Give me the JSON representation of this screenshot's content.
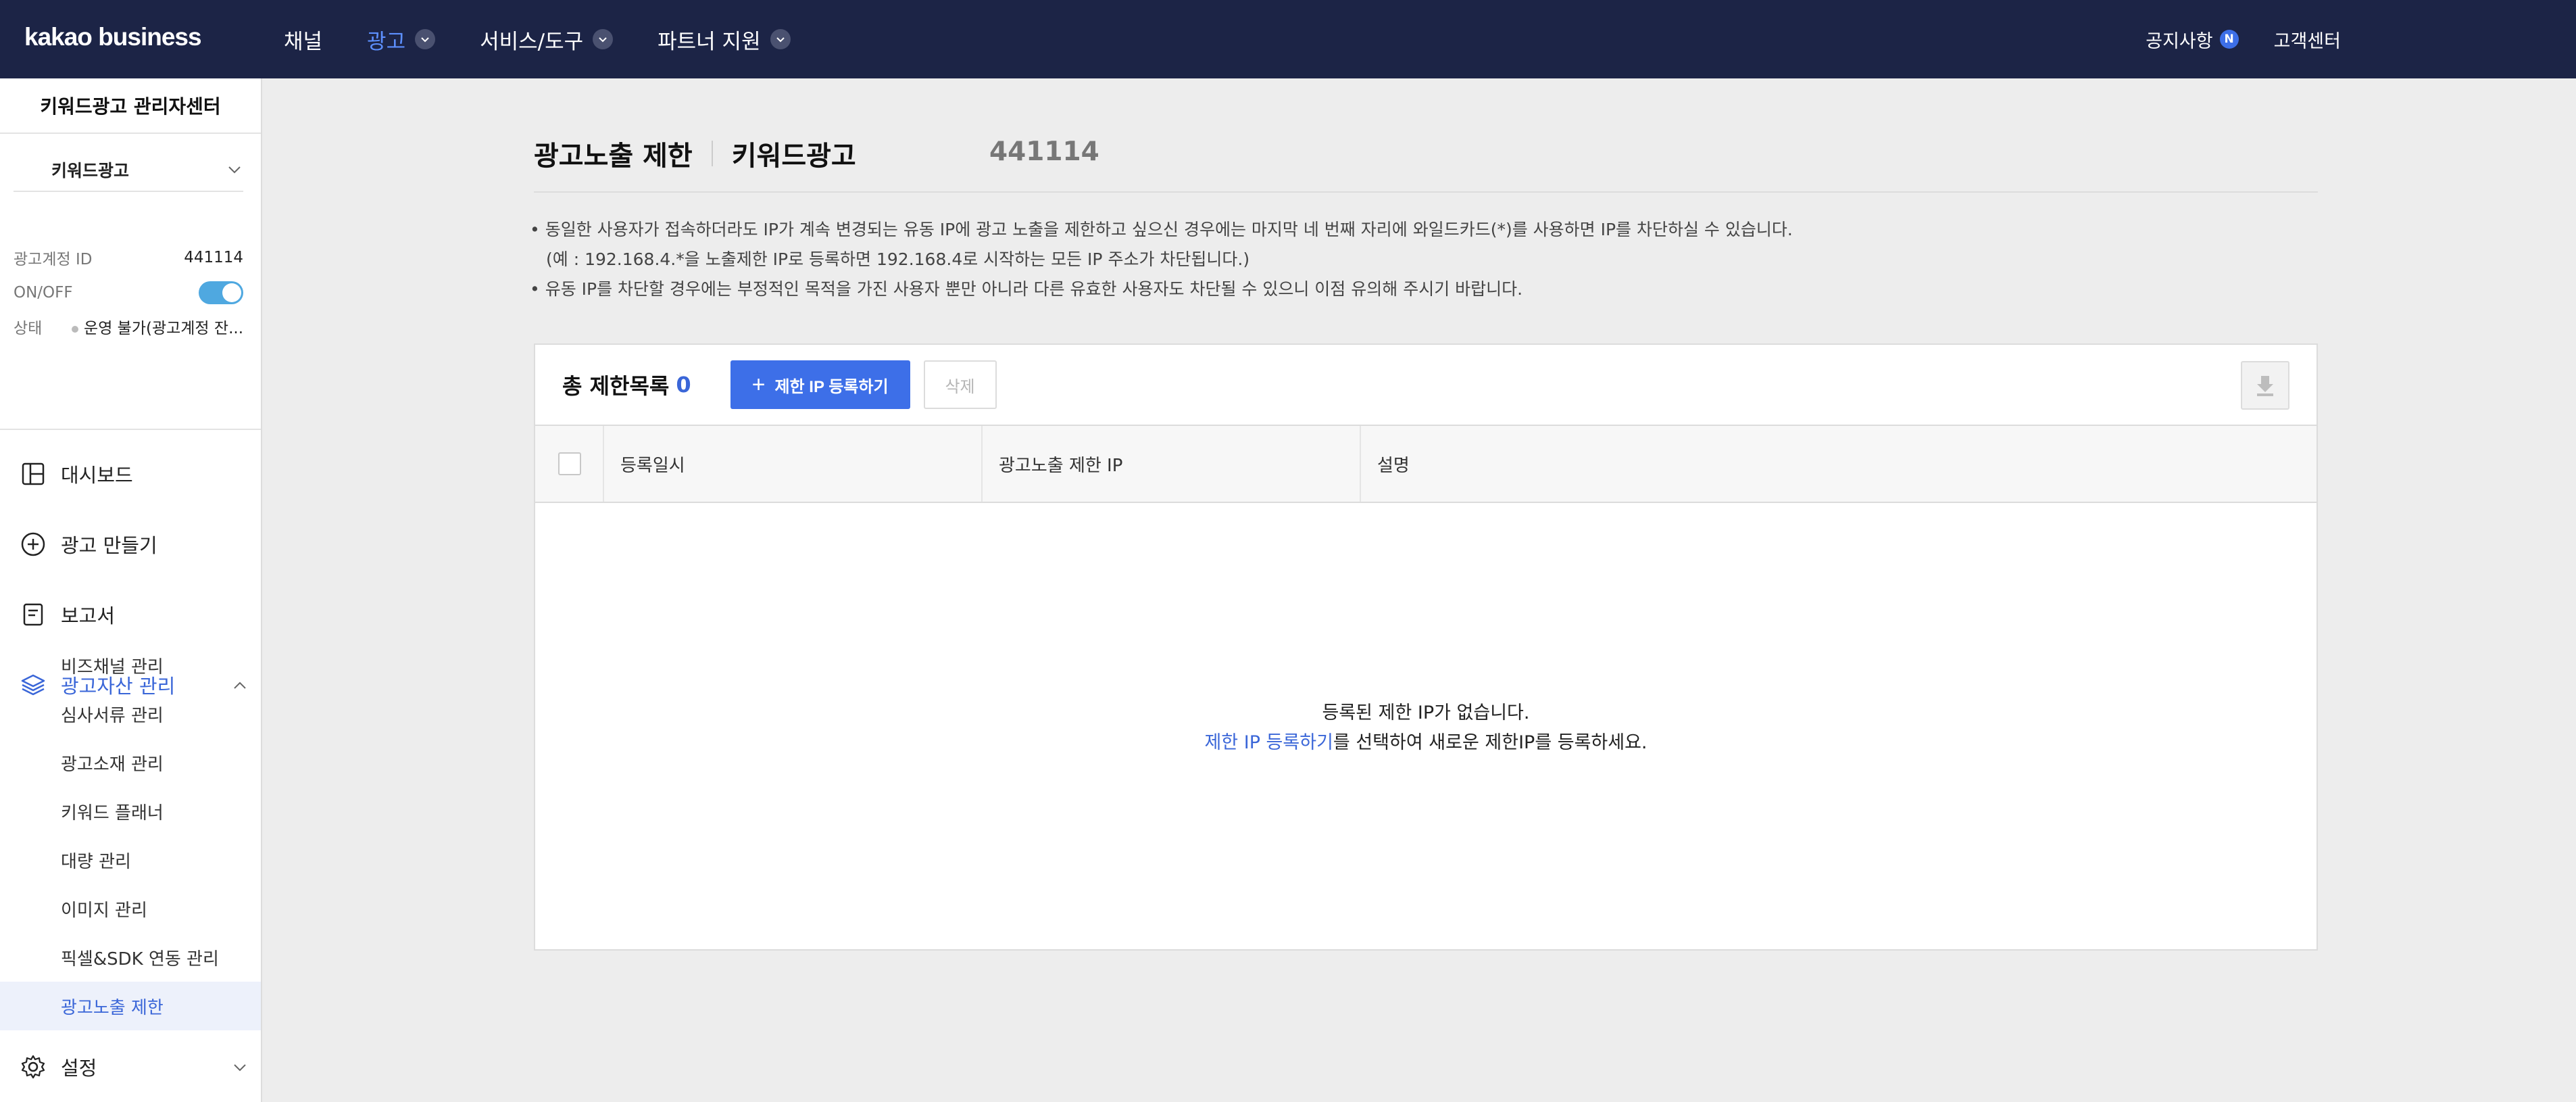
{
  "header": {
    "logo": "kakao business",
    "menu": [
      {
        "label": "채널",
        "has_dropdown": false,
        "active": false
      },
      {
        "label": "광고",
        "has_dropdown": true,
        "active": true
      },
      {
        "label": "서비스/도구",
        "has_dropdown": true,
        "active": false
      },
      {
        "label": "파트너 지원",
        "has_dropdown": true,
        "active": false
      }
    ],
    "notice_label": "공지사항",
    "notice_badge": "N",
    "support_label": "고객센터"
  },
  "sidebar": {
    "title": "키워드광고 관리자센터",
    "account_select": "키워드광고",
    "account_id_label": "광고계정 ID",
    "account_id_value": "441114",
    "onoff_label": "ON/OFF",
    "onoff_state": true,
    "status_label": "상태",
    "status_value": "운영 불가(광고계정 잔...",
    "nav": [
      {
        "label": "대시보드",
        "icon": "dashboard-icon"
      },
      {
        "label": "광고 만들기",
        "icon": "plus-circle-icon"
      },
      {
        "label": "보고서",
        "icon": "report-icon"
      },
      {
        "label": "광고자산 관리",
        "icon": "layers-icon",
        "expanded": true
      }
    ],
    "sub_items": [
      {
        "label": "비즈채널 관리",
        "active": false
      },
      {
        "label": "심사서류 관리",
        "active": false
      },
      {
        "label": "광고소재 관리",
        "active": false
      },
      {
        "label": "키워드 플래너",
        "active": false
      },
      {
        "label": "대량 관리",
        "active": false
      },
      {
        "label": "이미지 관리",
        "active": false
      },
      {
        "label": "픽셀&SDK 연동 관리",
        "active": false
      },
      {
        "label": "광고노출 제한",
        "active": true
      }
    ],
    "settings": {
      "label": "설정",
      "icon": "gear-icon"
    }
  },
  "main": {
    "title": "광고노출 제한",
    "subtitle": "키워드광고",
    "account_id": "441114",
    "desc": [
      "• 동일한 사용자가 접속하더라도 IP가 계속 변경되는 유동 IP에 광고 노출을 제한하고 싶으신 경우에는 마지막 네 번째 자리에 와일드카드(*)를 사용하면 IP를 차단하실 수 있습니다.",
      "(예 : 192.168.4.*을 노출제한 IP로 등록하면 192.168.4로 시작하는 모든 IP 주소가 차단됩니다.)",
      "• 유동 IP를 차단할 경우에는 부정적인 목적을 가진 사용자 뿐만 아니라 다른 유효한 사용자도 차단될 수 있으니 이점 유의해 주시기 바랍니다."
    ],
    "total_label": "총 제한목록",
    "total_count": "0",
    "register_button": "제한 IP 등록하기",
    "delete_button": "삭제",
    "columns": [
      "등록일시",
      "광고노출 제한 IP",
      "설명"
    ],
    "empty_message": "등록된 제한 IP가 없습니다.",
    "empty_link": "제한 IP 등록하기",
    "empty_suffix": "를 선택하여 새로운 제한IP를 등록하세요."
  },
  "colors": {
    "header_bg": "#1c2446",
    "accent": "#3d6fe8",
    "active_text": "#3a66d8",
    "toggle_on": "#4fa8e0",
    "page_bg": "#ededed"
  }
}
